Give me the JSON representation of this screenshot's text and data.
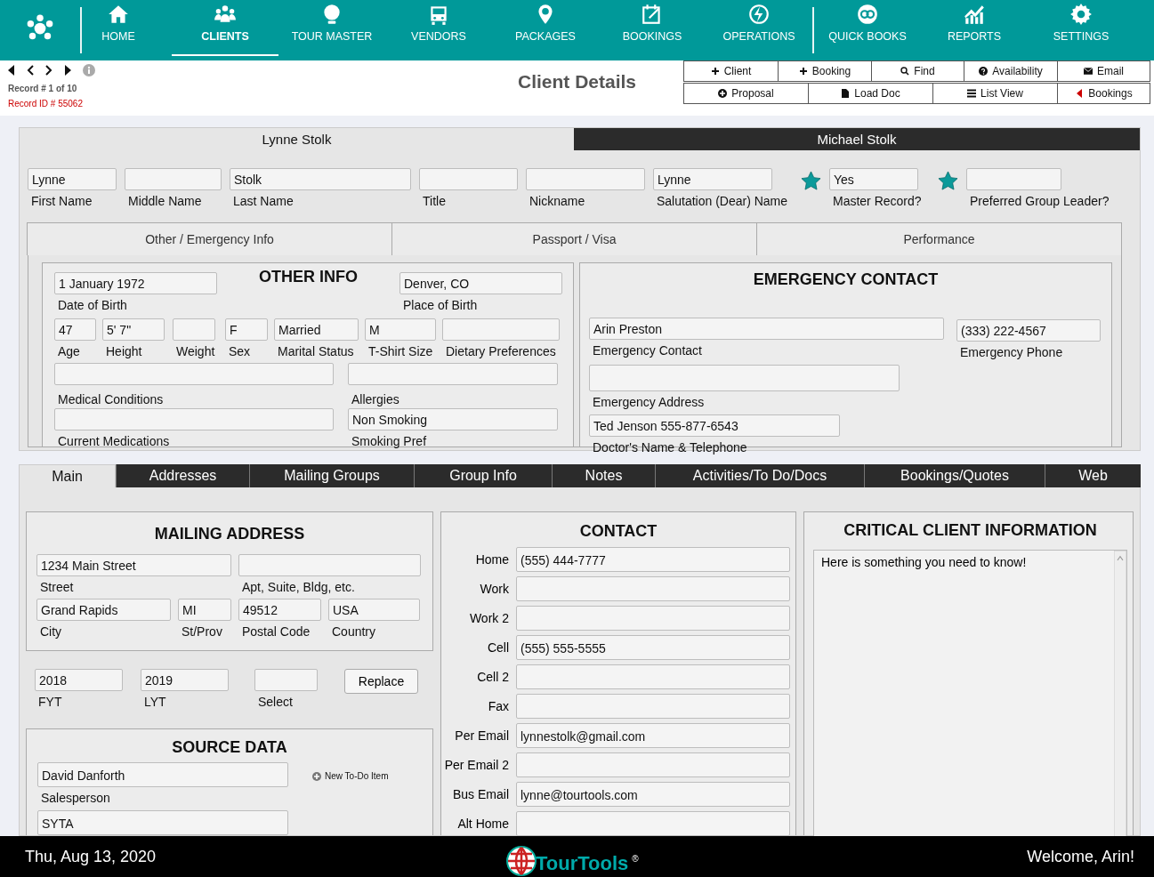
{
  "nav": {
    "items": [
      {
        "label": "HOME",
        "selected": false
      },
      {
        "label": "CLIENTS",
        "selected": true
      },
      {
        "label": "TOUR MASTER",
        "selected": false
      },
      {
        "label": "VENDORS",
        "selected": false
      },
      {
        "label": "PACKAGES",
        "selected": false
      },
      {
        "label": "BOOKINGS",
        "selected": false
      },
      {
        "label": "OPERATIONS",
        "selected": false
      },
      {
        "label": "QUICK BOOKS",
        "selected": false
      },
      {
        "label": "REPORTS",
        "selected": false
      },
      {
        "label": "SETTINGS",
        "selected": false
      }
    ]
  },
  "record": {
    "position": "Record # 1 of 10",
    "id": "Record ID # 55062"
  },
  "page_title": "Client Details",
  "actions": [
    [
      "Client",
      "Booking",
      "Find",
      "Availability",
      "Email"
    ],
    [
      "Proposal",
      "Load Doc",
      "List View",
      "Bookings"
    ]
  ],
  "person_tabs": [
    {
      "label": "Lynne Stolk",
      "selected": true
    },
    {
      "label": "Michael Stolk",
      "selected": false
    }
  ],
  "name_fields": [
    {
      "value": "Lynne",
      "label": "First Name"
    },
    {
      "label": "Middle Name"
    },
    {
      "value": "Stolk",
      "label": "Last Name"
    },
    {
      "label": "Title"
    },
    {
      "label": "Nickname"
    },
    {
      "value": "Lynne",
      "label": "Salutation (Dear) Name"
    },
    {
      "value": "Yes",
      "label": "Master Record?"
    },
    {
      "label": "Preferred Group Leader?"
    }
  ],
  "info_tabs": [
    "Other / Emergency Info",
    "Passport / Visa",
    "Performance"
  ],
  "other_info": {
    "title": "OTHER INFO",
    "fields": [
      {
        "value": "1 January 1972",
        "label": "Date of Birth"
      },
      {
        "value": "Denver, CO",
        "label": "Place of Birth"
      },
      {
        "value": "47",
        "label": "Age"
      },
      {
        "value": "5' 7\"",
        "label": "Height"
      },
      {
        "label": "Weight"
      },
      {
        "value": "F",
        "label": "Sex"
      },
      {
        "value": "Married",
        "label": "Marital Status"
      },
      {
        "value": "M",
        "label": "T-Shirt Size"
      },
      {
        "label": "Dietary Preferences"
      },
      {
        "label": "Medical Conditions"
      },
      {
        "label": "Allergies"
      },
      {
        "label": "Current Medications"
      },
      {
        "value": "Non Smoking",
        "label": "Smoking Pref"
      }
    ]
  },
  "emergency": {
    "title": "EMERGENCY CONTACT",
    "fields": [
      {
        "value": "Arin Preston",
        "label": "Emergency Contact"
      },
      {
        "value": "(333) 222-4567",
        "label": "Emergency Phone"
      },
      {
        "label": "Emergency Address"
      },
      {
        "value": "Ted Jenson 555-877-6543",
        "label": "Doctor's Name & Telephone"
      }
    ]
  },
  "record_tabs": [
    {
      "label": "Main",
      "selected": true
    },
    {
      "label": "Addresses",
      "selected": false
    },
    {
      "label": "Mailing Groups",
      "selected": false
    },
    {
      "label": "Group Info",
      "selected": false
    },
    {
      "label": "Notes",
      "selected": false
    },
    {
      "label": "Activities/To Do/Docs",
      "selected": false
    },
    {
      "label": "Bookings/Quotes",
      "selected": false
    },
    {
      "label": "Web",
      "selected": false
    }
  ],
  "mailing": {
    "title": "MAILING ADDRESS",
    "fields": [
      {
        "value": "1234 Main Street",
        "label": "Street"
      },
      {
        "label": "Apt, Suite, Bldg, etc."
      },
      {
        "value": "Grand Rapids",
        "label": "City"
      },
      {
        "value": "MI",
        "label": "St/Prov"
      },
      {
        "value": "49512",
        "label": "Postal Code"
      },
      {
        "value": "USA",
        "label": "Country"
      }
    ]
  },
  "years": {
    "fields": [
      {
        "value": "2018",
        "label": "FYT"
      },
      {
        "value": "2019",
        "label": "LYT"
      },
      {
        "label": "Select"
      }
    ],
    "button": "Replace"
  },
  "source": {
    "title": "SOURCE DATA",
    "fields": [
      {
        "value": "David Danforth",
        "label": "Salesperson"
      },
      {
        "value": "SYTA"
      }
    ],
    "todo": "New To-Do Item"
  },
  "contact": {
    "title": "CONTACT",
    "rows": [
      {
        "label": "Home",
        "value": "(555) 444-7777"
      },
      {
        "label": "Work"
      },
      {
        "label": "Work 2"
      },
      {
        "label": "Cell",
        "value": "(555) 555-5555"
      },
      {
        "label": "Cell 2"
      },
      {
        "label": "Fax"
      },
      {
        "label": "Per Email",
        "value": "lynnestolk@gmail.com"
      },
      {
        "label": "Per Email 2"
      },
      {
        "label": "Bus Email",
        "value": "lynne@tourtools.com"
      },
      {
        "label": "Alt Home"
      }
    ]
  },
  "critical": {
    "title": "CRITICAL CLIENT INFORMATION",
    "text": "Here is something you need to know!"
  },
  "footer": {
    "date": "Thu, Aug 13, 2020",
    "logo": "TourTools",
    "logo_mark": "®",
    "welcome": "Welcome, Arin!"
  }
}
